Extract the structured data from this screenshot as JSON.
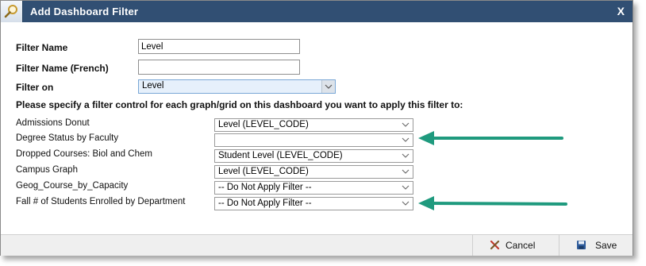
{
  "dialog": {
    "title": "Add Dashboard Filter",
    "close_label": "X"
  },
  "form": {
    "filter_name": {
      "label": "Filter Name",
      "value": "Level"
    },
    "filter_name_french": {
      "label": "Filter Name (French)",
      "value": ""
    },
    "filter_on": {
      "label": "Filter on",
      "selected": "Level"
    },
    "instruction": "Please specify a filter control for each graph/grid on this dashboard you want to apply this filter to:"
  },
  "graphs": [
    {
      "name": "Admissions Donut",
      "selected": "Level (LEVEL_CODE)"
    },
    {
      "name": "Degree Status by Faculty",
      "selected": ""
    },
    {
      "name": "Dropped Courses: Biol and Chem",
      "selected": "Student Level (LEVEL_CODE)"
    },
    {
      "name": "Campus Graph",
      "selected": "Level (LEVEL_CODE)"
    },
    {
      "name": "Geog_Course_by_Capacity",
      "selected": "-- Do Not Apply Filter --"
    },
    {
      "name": "Fall # of Students Enrolled by Department",
      "selected": "-- Do Not Apply Filter --"
    }
  ],
  "footer": {
    "cancel_label": "Cancel",
    "save_label": "Save"
  },
  "icons": {
    "title_icon": "magnifier-icon",
    "cancel_icon": "cancel-x-icon",
    "save_icon": "floppy-disk-icon"
  },
  "colors": {
    "titlebar": "#314f73",
    "arrow": "#1f9a7e"
  }
}
